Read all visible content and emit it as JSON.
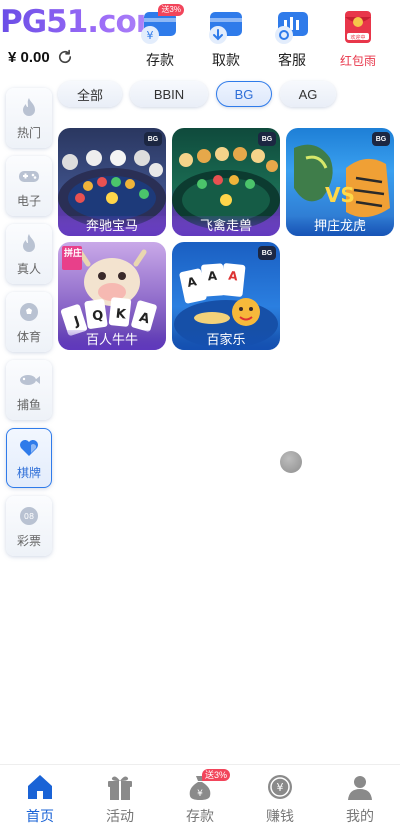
{
  "header": {
    "logo_text": "PG51.com",
    "balance": "¥ 0.00",
    "quick_actions": [
      {
        "label": "存款",
        "badge": "送3%"
      },
      {
        "label": "取款"
      },
      {
        "label": "客服"
      },
      {
        "label": "红包雨",
        "icon_text": "欢迎中"
      }
    ]
  },
  "tabs": [
    {
      "label": "全部",
      "active": false
    },
    {
      "label": "BBIN",
      "active": false
    },
    {
      "label": "BG",
      "active": true
    },
    {
      "label": "AG",
      "active": false
    }
  ],
  "categories": [
    {
      "label": "热门",
      "icon": "flame-icon"
    },
    {
      "label": "电子",
      "icon": "gamepad-icon"
    },
    {
      "label": "真人",
      "icon": "flame-icon"
    },
    {
      "label": "体育",
      "icon": "soccer-ball-icon"
    },
    {
      "label": "捕鱼",
      "icon": "fish-icon"
    },
    {
      "label": "棋牌",
      "icon": "heart-cards-icon",
      "active": true
    },
    {
      "label": "彩票",
      "icon": "lottery-ball-icon",
      "icon_text": "08"
    }
  ],
  "games": [
    {
      "name": "奔驰宝马",
      "provider": "BG"
    },
    {
      "name": "飞禽走兽",
      "provider": "BG"
    },
    {
      "name": "押庄龙虎",
      "provider": "BG"
    },
    {
      "name": "百人牛牛",
      "provider": "BG",
      "tag": "拼庄"
    },
    {
      "name": "百家乐",
      "provider": "BG"
    }
  ],
  "bottom_nav": [
    {
      "label": "首页",
      "active": true
    },
    {
      "label": "活动"
    },
    {
      "label": "存款",
      "badge": "送3%"
    },
    {
      "label": "赚钱"
    },
    {
      "label": "我的"
    }
  ],
  "colors": {
    "accent": "#1a63d6",
    "badge": "#f2455b",
    "logo": "#7b5cf0"
  }
}
